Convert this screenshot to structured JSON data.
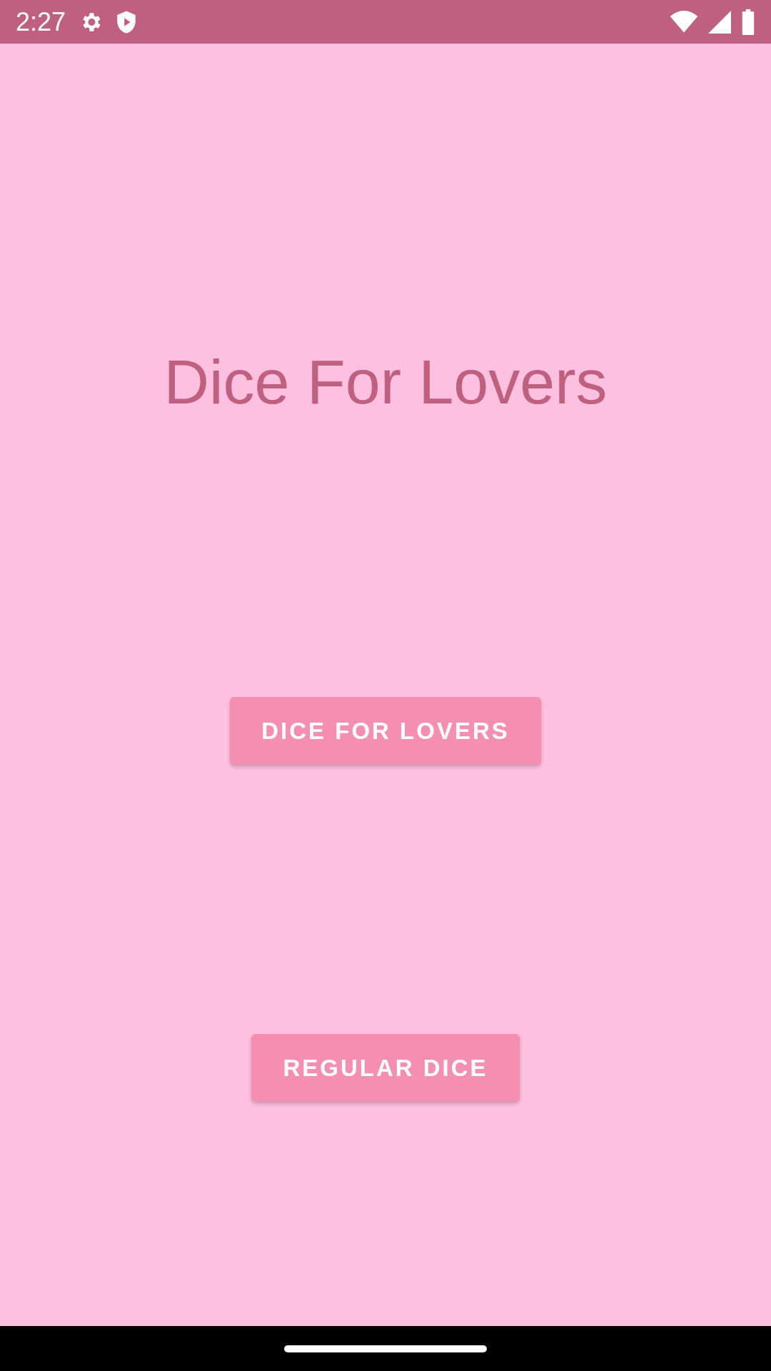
{
  "status_bar": {
    "time": "2:27"
  },
  "title": "Dice For Lovers",
  "buttons": [
    {
      "label": "DICE FOR LOVERS"
    },
    {
      "label": "REGULAR DICE"
    }
  ]
}
